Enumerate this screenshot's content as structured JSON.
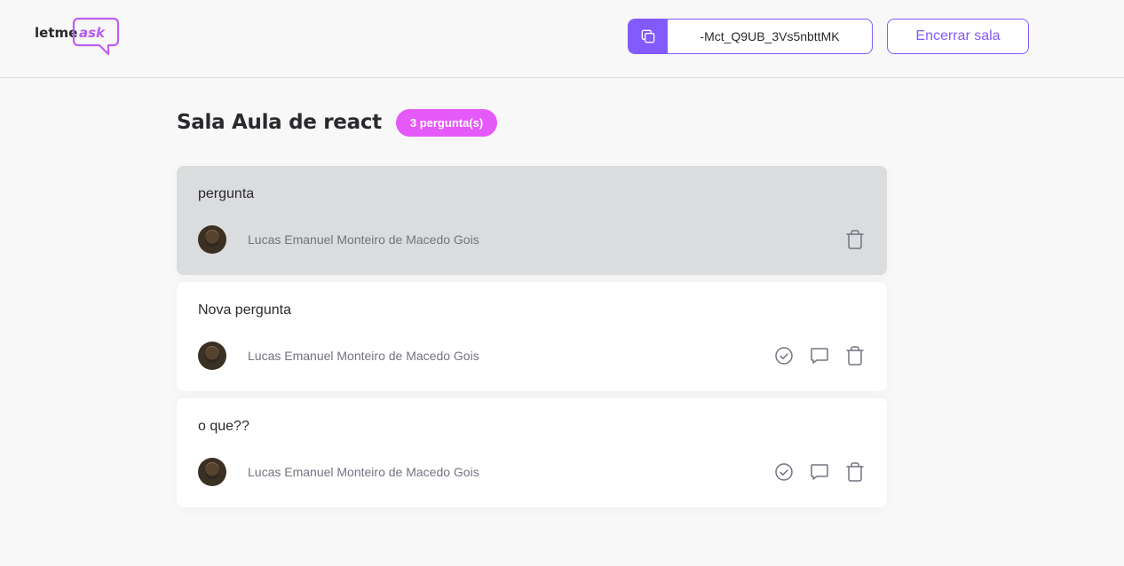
{
  "brand": {
    "logo_text_primary": "letme",
    "logo_text_accent": "ask"
  },
  "header": {
    "room_code": "-Mct_Q9UB_3Vs5nbttMK",
    "close_room_label": "Encerrar sala"
  },
  "room": {
    "title": "Sala Aula de react",
    "question_count_label": "3 pergunta(s)"
  },
  "questions": [
    {
      "content": "pergunta",
      "author": "Lucas Emanuel Monteiro de Macedo Gois",
      "highlighted": true
    },
    {
      "content": "Nova pergunta",
      "author": "Lucas Emanuel Monteiro de Macedo Gois",
      "highlighted": false
    },
    {
      "content": "o que??",
      "author": "Lucas Emanuel Monteiro de Macedo Gois",
      "highlighted": false
    }
  ],
  "colors": {
    "primary": "#835afd",
    "pink": "#e559f9",
    "background": "#f8f8f8",
    "highlighted_card": "#dbdcdd",
    "icon": "#737380"
  },
  "icons": {
    "copy": "copy-icon",
    "check": "check-circle-icon",
    "answer": "chat-bubble-icon",
    "delete": "trash-icon"
  }
}
